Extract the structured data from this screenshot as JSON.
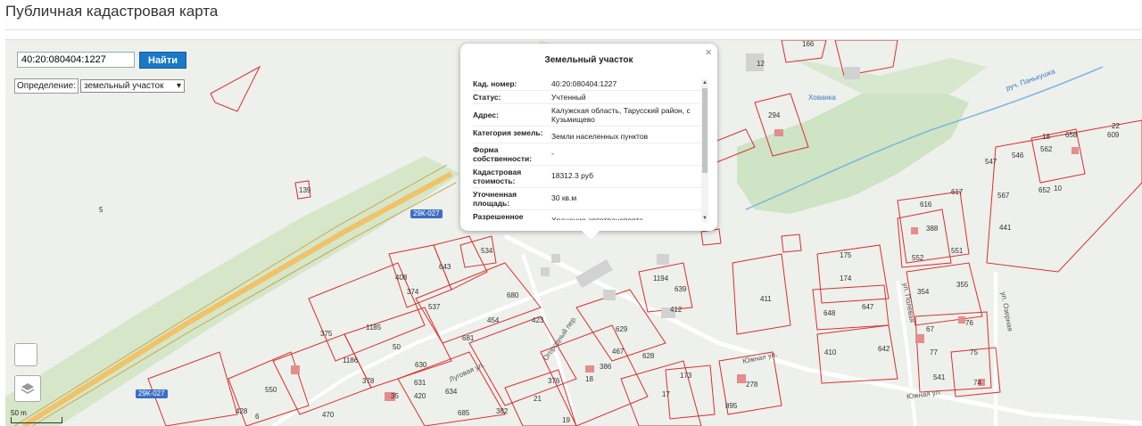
{
  "page": {
    "title": "Публичная кадастровая карта"
  },
  "search": {
    "value": "40:20:080404:1227",
    "button_label": "Найти"
  },
  "definition": {
    "label": "Определение:",
    "selected": "земельный участок"
  },
  "scale": {
    "label": "50 m"
  },
  "route": {
    "label_1": "29К-027",
    "label_2": "29К-027"
  },
  "popup": {
    "title": "Земельный участок",
    "close": "×",
    "rows": [
      {
        "key": "Кад. номер:",
        "value": "40:20:080404:1227"
      },
      {
        "key": "Статус:",
        "value": "Учтенный"
      },
      {
        "key": "Адрес:",
        "value": "Калужская область, Тарусский район, с Кузьмищево"
      },
      {
        "key": "Категория земель:",
        "value": "Земли населенных пунктов"
      },
      {
        "key": "Форма собственности:",
        "value": "-"
      },
      {
        "key": "Кадастровая стоимость:",
        "value": "18312.3 руб"
      },
      {
        "key": "Уточненная площадь:",
        "value": "30 кв.м"
      },
      {
        "key": "Разрешенное",
        "value": "Хранение автотранспорта"
      }
    ]
  },
  "streets": {
    "s1": "Южная ул.",
    "s2": "Южная ул.",
    "s3": "ул. Полевая",
    "s4": "ул. Озерная",
    "s5": "Огородный пер.",
    "s6": "Луговая ул.",
    "s7": "руч. Панькушка",
    "s8": "Хованка"
  },
  "parcels": {
    "p1": "166",
    "p2": "12",
    "p3": "294",
    "p4": "22",
    "p5": "609",
    "p6": "658",
    "p7": "562",
    "p8": "18",
    "p9": "546",
    "p10": "547",
    "p11": "567",
    "p12": "652",
    "p13": "10",
    "p14": "441",
    "p15": "616",
    "p16": "617",
    "p17": "388",
    "p18": "552",
    "p19": "551",
    "p20": "354",
    "p21": "355",
    "p22": "175",
    "p23": "174",
    "p24": "648",
    "p25": "647",
    "p26": "410",
    "p27": "642",
    "p28": "67",
    "p29": "76",
    "p30": "77",
    "p31": "75",
    "p32": "541",
    "p33": "74",
    "p34": "411",
    "p35": "278",
    "p36": "895",
    "p37": "173",
    "p38": "1194",
    "p39": "639",
    "p40": "412",
    "p41": "629",
    "p42": "467",
    "p43": "628",
    "p44": "386",
    "p45": "376",
    "p46": "18",
    "p47": "21",
    "p48": "19",
    "p49": "17",
    "p50": "537",
    "p51": "408",
    "p52": "643",
    "p53": "534",
    "p54": "374",
    "p55": "375",
    "p56": "1185",
    "p57": "50",
    "p58": "630",
    "p59": "681",
    "p60": "454",
    "p61": "423",
    "p62": "680",
    "p63": "378",
    "p64": "550",
    "p65": "428",
    "p66": "470",
    "p67": "35",
    "p68": "420",
    "p69": "634",
    "p70": "685",
    "p71": "382",
    "p72": "1186",
    "p73": "5",
    "p74": "139",
    "p75": "631",
    "p76": "6"
  }
}
